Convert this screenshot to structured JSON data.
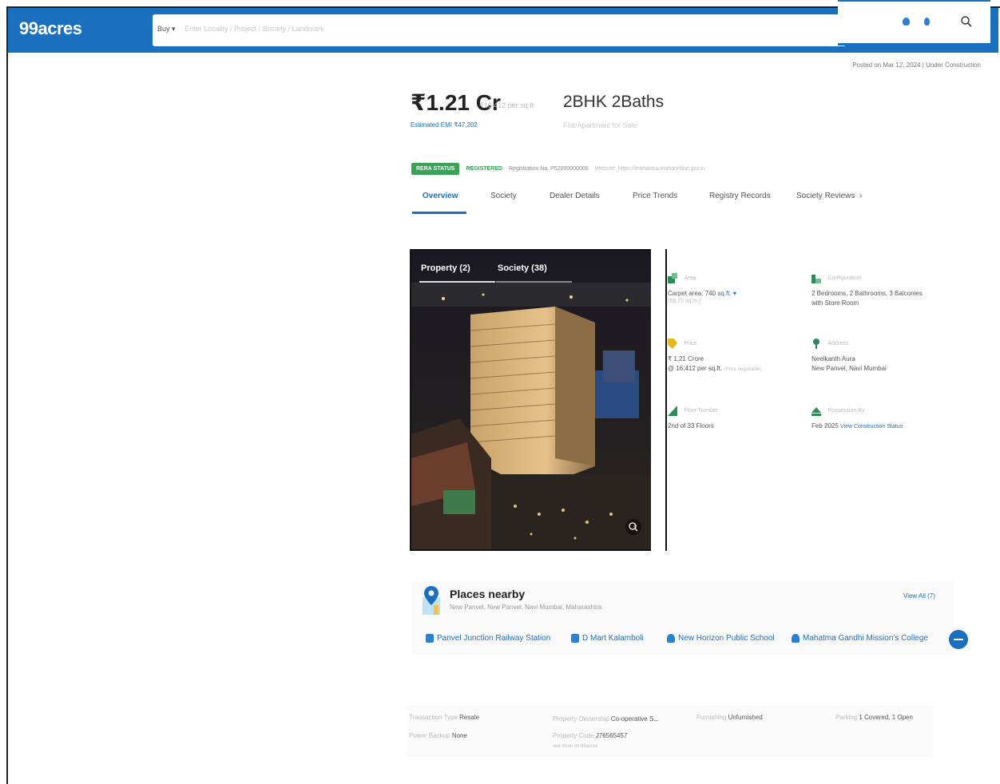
{
  "header": {
    "logo": "99acres",
    "buy_label": "Buy ▾",
    "search_placeholder": "Enter Locality / Project / Society / Landmark"
  },
  "posted": "Posted on Mar 12, 2024  |  Under Construction",
  "listing": {
    "price": "₹1.21 Cr",
    "price_sub": "₹16,412 per sq.ft",
    "emi": "Estimated EMI ₹47,202",
    "config": "2BHK 2Baths",
    "config_sub": "Flat/Apartment for Sale",
    "rera_status": "RERA STATUS",
    "registered": "REGISTERED",
    "reg_no": "Registration No. P52000000000",
    "reg_url": "Website: https://maharera.mahaonline.gov.in"
  },
  "tabs": [
    "Overview",
    "Society",
    "Dealer Details",
    "Price Trends",
    "Registry Records",
    "Society Reviews"
  ],
  "tab_arrow": "›",
  "gallery": {
    "tab_property": "Property (2)",
    "tab_society": "Society (38)"
  },
  "details": {
    "area_head": "Area",
    "area_line1": "Carpet area: 740 ",
    "area_unit": "sq.ft. ▾",
    "area_faint": "(68.75 sq.m.)",
    "config_head": "Configuration",
    "config_line1": "2 Bedrooms, 2 Bathrooms, 3 Balconies",
    "config_line2": "with Store Room",
    "price_head": "Price",
    "price_line1": "₹ 1.21 Crore",
    "price_line2": "@ 16,412 per sq.ft. ",
    "price_negotiable": "(Price negotiable)",
    "address_head": "Address",
    "address_line1": "Neelkanth Aura",
    "address_line2": "New Panvel, Navi Mumbai",
    "floor_head": "Floor Number",
    "floor_line1": "2nd of 33 Floors",
    "possession_head": "Possession By",
    "possession_line1": "Feb 2025 ",
    "possession_link": "View Construction Status"
  },
  "places": {
    "title": "Places nearby",
    "sub": "New Panvel, New Panvel, Navi Mumbai, Maharashtra",
    "view_all": "View All (7)",
    "chips": [
      "Panvel Junction Railway Station",
      "D Mart Kalamboli",
      "New Horizon Public School",
      "Mahatma Gandhi Mission's College"
    ]
  },
  "facts": {
    "transaction_k": "Transaction Type ",
    "transaction_v": "Resale",
    "ownership_k": "Property Ownership ",
    "ownership_v": "Co-operative S...",
    "furnishing_k": "Furnishing ",
    "furnishing_v": "Unfurnished",
    "parking_k": "Parking ",
    "parking_v": "1 Covered, 1 Open",
    "power_k": "Power Backup ",
    "power_v": "None",
    "code_k": "Property Code ",
    "code_v": "J76565457",
    "code_sub": "see more on 99acres"
  },
  "colors": {
    "brand": "#1b6fbf",
    "rera_green": "#36a357"
  }
}
